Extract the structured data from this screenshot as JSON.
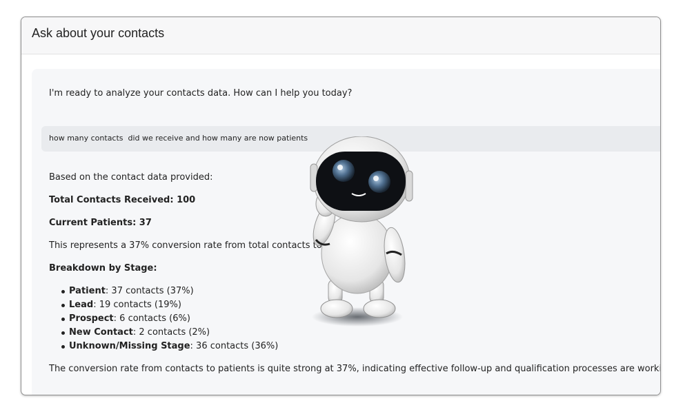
{
  "panel": {
    "title": "Ask about your contacts"
  },
  "chat": {
    "assistant_intro": "I'm ready to analyze your contacts data. How can I help you today?",
    "user_message": "how many contacts  did we receive and how many are now patients",
    "answer": {
      "intro": "Based on the contact data provided:",
      "total_contacts": "Total Contacts Received: 100",
      "current_patients": "Current Patients: 37",
      "conversion_note": "This represents a 37% conversion rate from total contacts to patients.",
      "breakdown_heading": "Breakdown by Stage:",
      "stages": [
        {
          "name": "Patient",
          "detail": ": 37 contacts (37%)"
        },
        {
          "name": "Lead",
          "detail": ": 19 contacts (19%)"
        },
        {
          "name": "Prospect",
          "detail": ": 6 contacts (6%)"
        },
        {
          "name": "New Contact",
          "detail": ": 2 contacts (2%)"
        },
        {
          "name": "Unknown/Missing Stage",
          "detail": ": 36 contacts (36%)"
        }
      ],
      "conclusion": "The conversion rate from contacts to patients is quite strong at 37%, indicating effective follow-up and qualification processes are working well for your practice."
    }
  },
  "colors": {
    "page_background": "#ffffff",
    "chat_background": "#f6f7f9",
    "user_bubble": "#e9ebee",
    "robot_visor": "#0e1014",
    "robot_eye": "#4f6f8f"
  },
  "mascot": {
    "icon": "robot-mascot-icon"
  }
}
